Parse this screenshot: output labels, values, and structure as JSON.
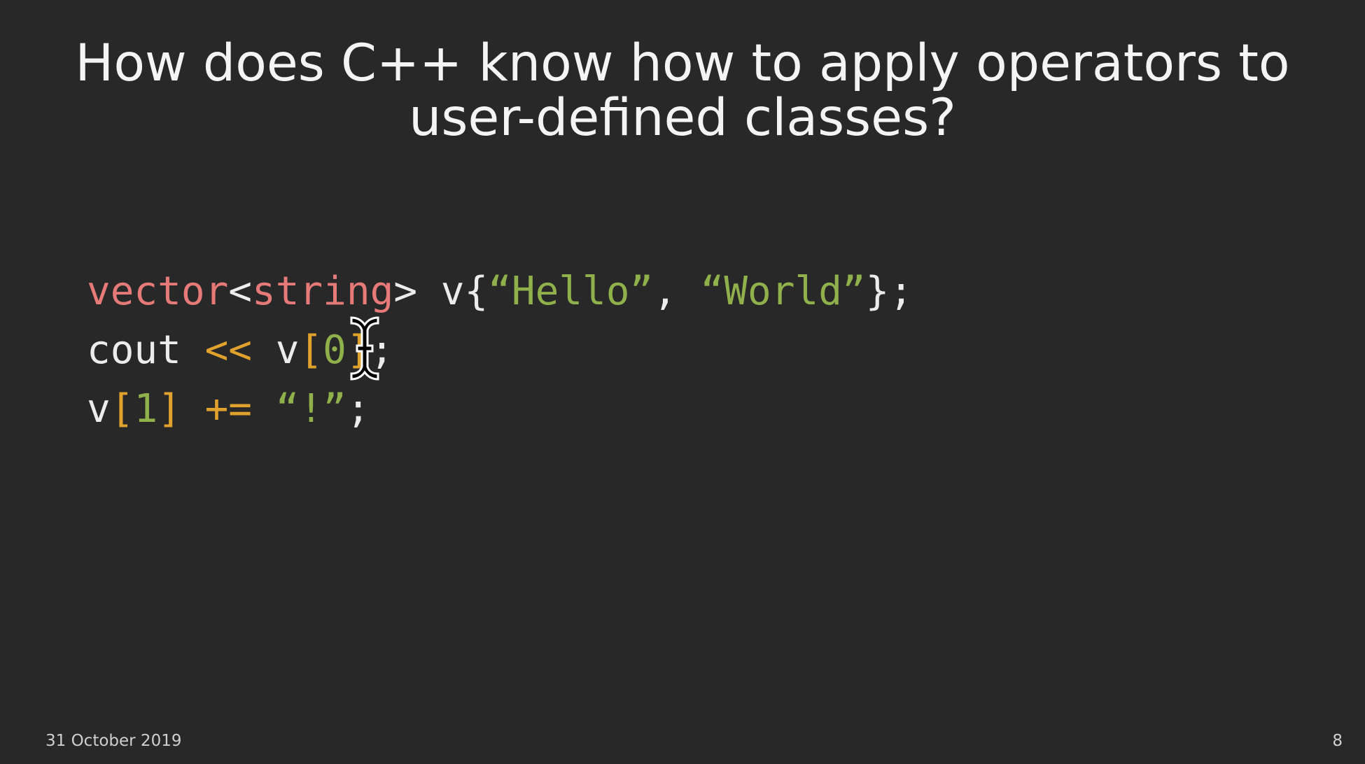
{
  "slide": {
    "title_lines": [
      "How does C++ know how to apply operators to",
      "user-defined classes?"
    ],
    "code": [
      [
        {
          "t": "vector",
          "c": "kw"
        },
        {
          "t": "<",
          "c": "plain"
        },
        {
          "t": "string",
          "c": "kw"
        },
        {
          "t": "> v{",
          "c": "plain"
        },
        {
          "t": "“Hello”",
          "c": "str"
        },
        {
          "t": ", ",
          "c": "plain"
        },
        {
          "t": "“World”",
          "c": "str"
        },
        {
          "t": "};",
          "c": "plain"
        }
      ],
      [
        {
          "t": "cout ",
          "c": "plain"
        },
        {
          "t": "<<",
          "c": "op"
        },
        {
          "t": " v",
          "c": "plain"
        },
        {
          "t": "[",
          "c": "op"
        },
        {
          "t": "0",
          "c": "num"
        },
        {
          "t": "]",
          "c": "op"
        },
        {
          "t": ";",
          "c": "plain"
        }
      ],
      [
        {
          "t": "v",
          "c": "plain"
        },
        {
          "t": "[",
          "c": "op"
        },
        {
          "t": "1",
          "c": "num"
        },
        {
          "t": "]",
          "c": "op"
        },
        {
          "t": " ",
          "c": "plain"
        },
        {
          "t": "+=",
          "c": "op"
        },
        {
          "t": " ",
          "c": "plain"
        },
        {
          "t": "“!”",
          "c": "str"
        },
        {
          "t": ";",
          "c": "plain"
        }
      ]
    ],
    "footer": {
      "date": "31 October 2019",
      "page_number": "8"
    },
    "cursor_icon": "text-ibeam-cursor",
    "colors": {
      "background": "#282828",
      "keyword": "#e57a78",
      "string": "#8fb04a",
      "operator": "#e0a22c",
      "text": "#ececec"
    }
  }
}
